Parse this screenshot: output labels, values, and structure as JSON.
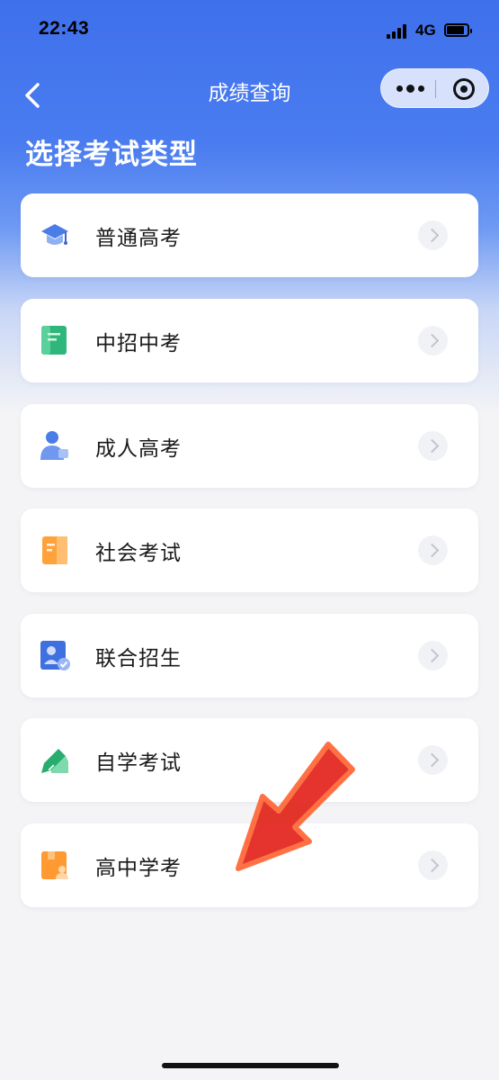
{
  "status_bar": {
    "time": "22:43",
    "network": "4G"
  },
  "nav": {
    "title": "成绩查询"
  },
  "page_title": "选择考试类型",
  "exam_types": [
    {
      "label": "普通高考",
      "icon": "graduation-cap-icon"
    },
    {
      "label": "中招中考",
      "icon": "green-document-icon"
    },
    {
      "label": "成人高考",
      "icon": "adult-user-icon"
    },
    {
      "label": "社会考试",
      "icon": "orange-certificate-icon"
    },
    {
      "label": "联合招生",
      "icon": "blue-id-card-icon"
    },
    {
      "label": "自学考试",
      "icon": "green-pen-icon"
    },
    {
      "label": "高中学考",
      "icon": "orange-student-book-icon"
    }
  ],
  "colors": {
    "accent_blue": "#3f70ec",
    "annotation_arrow": "#e32a22"
  }
}
